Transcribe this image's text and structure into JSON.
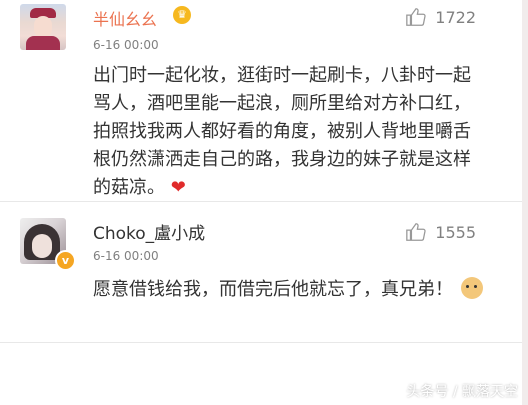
{
  "comments": [
    {
      "username": "半仙幺幺",
      "time": "6-16 00:00",
      "likes": "1722",
      "text": "出门时一起化妆，逛街时一起刷卡，八卦时一起骂人，酒吧里能一起浪，厕所里给对方补口红，拍照找我两人都好看的角度，被别人背地里嚼舌根仍然潇洒走自己的路，我身边的妹子就是这样的菇凉。",
      "emoji": "❤"
    },
    {
      "username": "Choko_盧小成",
      "time": "6-16 00:00",
      "likes": "1555",
      "text": "愿意借钱给我，而借完后他就忘了，真兄弟！",
      "badge": "v"
    }
  ],
  "watermark": "头条号 / 飘落天空",
  "colors": {
    "username_vip": "#eb7350",
    "heart": "#e02b2b",
    "badge": "#f5a623"
  },
  "icons": [
    "crown-icon",
    "thumb-up-icon",
    "heart-emoji-icon",
    "verified-badge-icon",
    "doge-emoji-icon"
  ]
}
